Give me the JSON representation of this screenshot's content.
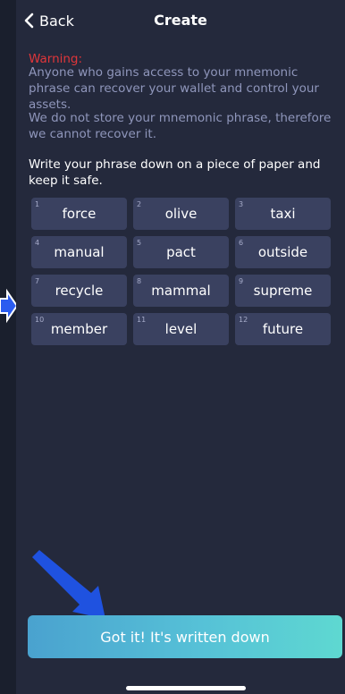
{
  "header": {
    "back_label": "Back",
    "title": "Create"
  },
  "content": {
    "warning_label": "Warning:",
    "warning_text": "Anyone who gains access to your mnemonic phrase can recover your wallet and control your assets.",
    "no_store_text": "We do not store your mnemonic phrase, therefore we cannot recover it.",
    "instruction_text": "Write your phrase down on a piece of paper and keep it safe."
  },
  "words": [
    {
      "num": "1",
      "word": "force"
    },
    {
      "num": "2",
      "word": "olive"
    },
    {
      "num": "3",
      "word": "taxi"
    },
    {
      "num": "4",
      "word": "manual"
    },
    {
      "num": "5",
      "word": "pact"
    },
    {
      "num": "6",
      "word": "outside"
    },
    {
      "num": "7",
      "word": "recycle"
    },
    {
      "num": "8",
      "word": "mammal"
    },
    {
      "num": "9",
      "word": "supreme"
    },
    {
      "num": "10",
      "word": "member"
    },
    {
      "num": "11",
      "word": "level"
    },
    {
      "num": "12",
      "word": "future"
    }
  ],
  "confirm_button": {
    "label": "Got it! It's written down"
  },
  "colors": {
    "background": "#24293c",
    "cell": "#3a4160",
    "warning": "#e0363a",
    "muted_text": "#8f96bb",
    "button_gradient_start": "#4aa2cf",
    "button_gradient_end": "#5ed8d1",
    "hint_arrow": "#1f52e0"
  },
  "icons": {
    "back": "chevron-left-icon",
    "hint_arrow": "arrow-down-right-icon",
    "side_arrow": "arrow-right-icon"
  }
}
